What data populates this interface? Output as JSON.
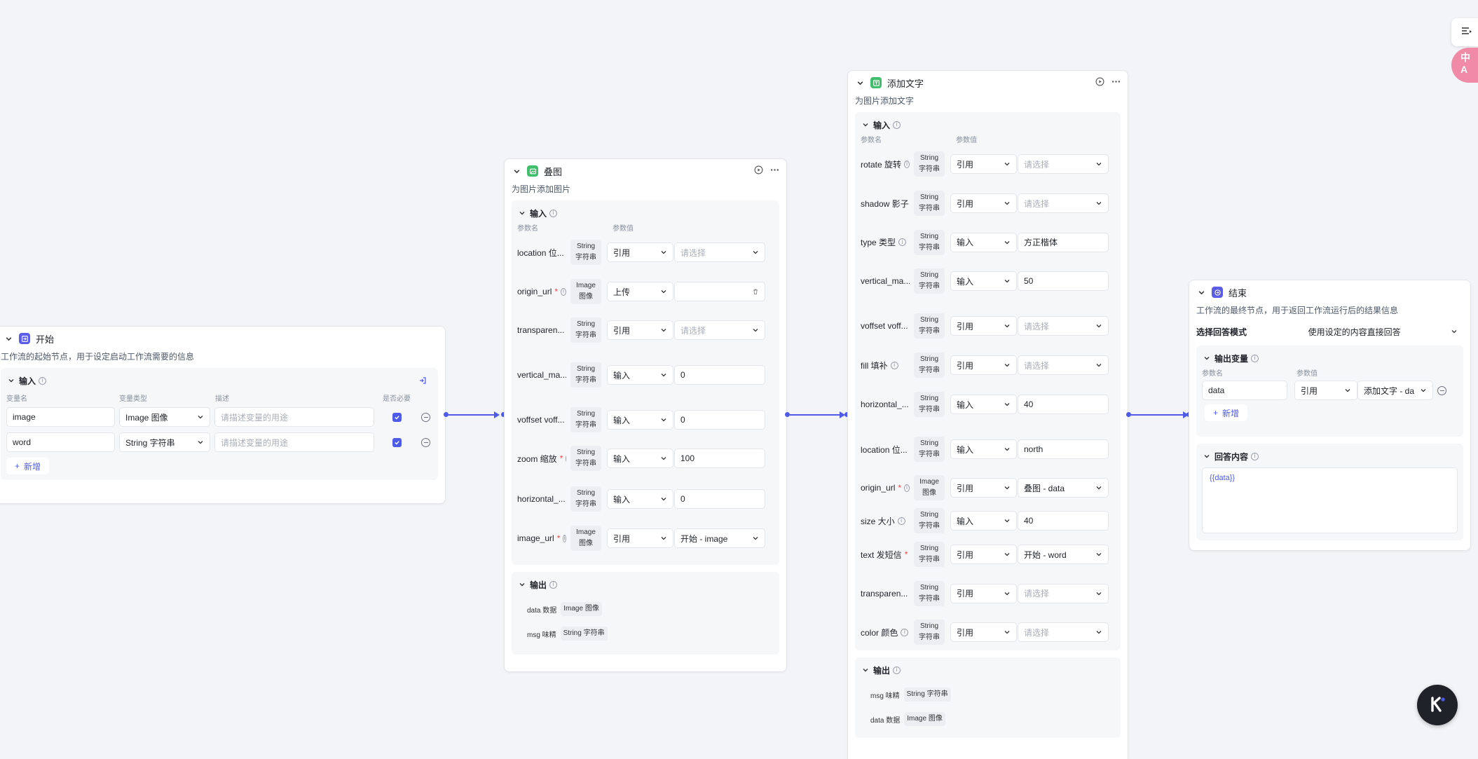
{
  "start_node": {
    "title": "开始",
    "desc": "工作流的起始节点，用于设定启动工作流需要的信息",
    "input_label": "输入",
    "col_var_name": "变量名",
    "col_var_type": "变量类型",
    "col_desc": "描述",
    "col_required": "是否必要",
    "rows": [
      {
        "name": "image",
        "type": "Image 图像",
        "placeholder": "请描述变量的用途"
      },
      {
        "name": "word",
        "type": "String 字符串",
        "placeholder": "请描述变量的用途"
      }
    ],
    "add_label": "新增"
  },
  "overlay_node": {
    "title": "叠图",
    "desc": "为图片添加图片",
    "input_label": "输入",
    "col_param": "参数名",
    "col_value": "参数值",
    "params": [
      {
        "name": "location 位...",
        "badge": "String 字符串",
        "mode": "引用",
        "value": "请选择",
        "ph": true,
        "kind": "select"
      },
      {
        "name": "origin_url",
        "req": true,
        "badge": "Image 图像",
        "mode": "上传",
        "value": "",
        "kind": "upload"
      },
      {
        "name": "transparen...",
        "badge": "String 字符串",
        "mode": "引用",
        "value": "请选择",
        "ph": true,
        "kind": "select"
      },
      {
        "name": "vertical_ma...",
        "badge": "String 字符串",
        "mode": "输入",
        "value": "0",
        "kind": "input"
      },
      {
        "name": "voffset voff...",
        "badge": "String 字符串",
        "mode": "输入",
        "value": "0",
        "kind": "input"
      },
      {
        "name": "zoom 缩放",
        "req": true,
        "badge": "String 字符串",
        "mode": "输入",
        "value": "100",
        "kind": "input"
      },
      {
        "name": "horizontal_...",
        "badge": "String 字符串",
        "mode": "输入",
        "value": "0",
        "kind": "input"
      },
      {
        "name": "image_url",
        "req": true,
        "badge": "Image 图像",
        "mode": "引用",
        "value": "开始 - image",
        "kind": "select"
      }
    ],
    "output_label": "输出",
    "outputs": [
      {
        "name": "data 数据",
        "type": "Image 图像"
      },
      {
        "name": "msg 味精",
        "type": "String 字符串"
      }
    ]
  },
  "text_node": {
    "title": "添加文字",
    "desc": "为图片添加文字",
    "input_label": "输入",
    "col_param": "参数名",
    "col_value": "参数值",
    "params": [
      {
        "name": "rotate 旋转",
        "badge": "String 字符串",
        "mode": "引用",
        "value": "请选择",
        "ph": true,
        "kind": "select"
      },
      {
        "name": "shadow 影子",
        "badge": "String 字符串",
        "mode": "引用",
        "value": "请选择",
        "ph": true,
        "kind": "select"
      },
      {
        "name": "type 类型",
        "badge": "String 字符串",
        "mode": "输入",
        "value": "方正楷体",
        "kind": "input"
      },
      {
        "name": "vertical_ma...",
        "badge": "String 字符串",
        "mode": "输入",
        "value": "50",
        "kind": "input"
      },
      {
        "name": "voffset voff...",
        "badge": "String 字符串",
        "mode": "引用",
        "value": "请选择",
        "ph": true,
        "kind": "select"
      },
      {
        "name": "fill 填补",
        "badge": "String 字符串",
        "mode": "引用",
        "value": "请选择",
        "ph": true,
        "kind": "select"
      },
      {
        "name": "horizontal_...",
        "badge": "String 字符串",
        "mode": "输入",
        "value": "40",
        "kind": "input"
      },
      {
        "name": "location 位...",
        "badge": "String 字符串",
        "mode": "输入",
        "value": "north",
        "kind": "input"
      },
      {
        "name": "origin_url",
        "req": true,
        "badge": "Image 图像",
        "mode": "引用",
        "value": "叠图 - data",
        "kind": "select"
      },
      {
        "name": "size 大小",
        "badge": "String 字符串",
        "mode": "输入",
        "value": "40",
        "kind": "input"
      },
      {
        "name": "text 发短信",
        "req": true,
        "badge": "String 字符串",
        "mode": "引用",
        "value": "开始 - word",
        "kind": "select"
      },
      {
        "name": "transparen...",
        "badge": "String 字符串",
        "mode": "引用",
        "value": "请选择",
        "ph": true,
        "kind": "select"
      },
      {
        "name": "color 颜色",
        "badge": "String 字符串",
        "mode": "引用",
        "value": "请选择",
        "ph": true,
        "kind": "select"
      }
    ],
    "output_label": "输出",
    "outputs": [
      {
        "name": "msg 味精",
        "type": "String 字符串"
      },
      {
        "name": "data 数据",
        "type": "Image 图像"
      }
    ]
  },
  "end_node": {
    "title": "结束",
    "desc": "工作流的最终节点，用于返回工作流运行后的结果信息",
    "mode_label": "选择回答模式",
    "mode_value": "使用设定的内容直接回答",
    "output_var_label": "输出变量",
    "col_param": "参数名",
    "col_value": "参数值",
    "var_name": "data",
    "var_mode": "引用",
    "var_value": "添加文字 - da",
    "add_label": "新增",
    "answer_label": "回答内容",
    "answer_text": "{{data}}"
  },
  "floating": {
    "badge_text": "中\nA"
  },
  "colors": {
    "accent": "#4e5be8",
    "start_icon": "#5b5ce8",
    "tool_icon": "#3fbf6b",
    "end_icon": "#5b5ce8"
  }
}
